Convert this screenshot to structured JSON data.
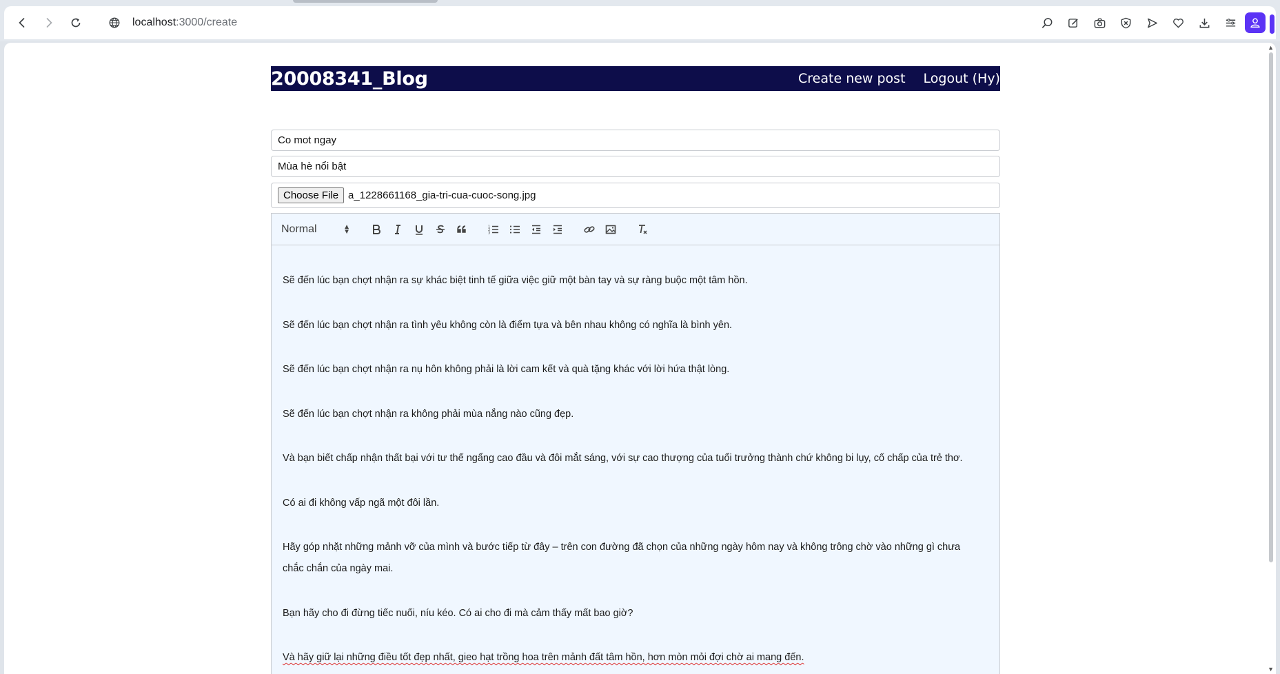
{
  "browser": {
    "url_host": "localhost",
    "url_path": ":3000/create",
    "icons": [
      "back-icon",
      "forward-icon",
      "reload-icon",
      "globe-icon",
      "search-lens-icon",
      "edit-icon",
      "camera-icon",
      "shield-x-icon",
      "send-icon",
      "heart-icon",
      "download-icon",
      "menu-icon",
      "profile-icon"
    ]
  },
  "header": {
    "brand": "20008341_Blog",
    "create_link": "Create new post",
    "logout_link": "Logout (Hy)"
  },
  "form": {
    "title_value": "Co mot ngay",
    "description_value": "Mùa hè nổi bật",
    "file_button": "Choose File",
    "file_name": "a_1228661168_gia-tri-cua-cuoc-song.jpg"
  },
  "editor": {
    "header_picker": "Normal",
    "toolbar_tools": [
      "bold-icon",
      "italic-icon",
      "underline-icon",
      "strike-icon",
      "blockquote-icon",
      "ordered-list-icon",
      "bullet-list-icon",
      "outdent-icon",
      "indent-icon",
      "link-icon",
      "image-icon",
      "clean-icon"
    ],
    "paragraphs": [
      "Sẽ đến lúc bạn chợt nhận ra sự khác biệt tinh tế giữa việc giữ một bàn tay và sự ràng buộc một tâm hồn.",
      "Sẽ đến lúc bạn chợt nhận ra tình yêu không còn là điểm tựa và bên nhau không có nghĩa là bình yên.",
      "Sẽ đến lúc bạn chợt nhận ra nụ hôn không phải là lời cam kết và quà tặng khác với lời hứa thật lòng.",
      "Sẽ đến lúc bạn chợt nhận ra không phải mùa nắng nào cũng đẹp.",
      "Và bạn biết chấp nhận thất bại với tư thế ngẩng cao đầu và đôi mắt sáng, với sự cao thượng của tuổi trưởng thành chứ không bi lụy, cố chấp của trẻ thơ.",
      "Có ai đi không vấp ngã một đôi lần.",
      "Hãy góp nhặt những mảnh vỡ của mình và bước tiếp từ đây – trên con đường đã chọn của những ngày hôm nay và không trông chờ vào những gì chưa chắc chắn của ngày mai.",
      "Bạn hãy cho đi đừng tiếc nuối, níu kéo. Có ai cho đi mà cảm thấy mất bao giờ?",
      "Và hãy giữ lại những điều tốt đẹp nhất, gieo hạt trồng hoa trên mảnh đất tâm hồn, hơn mòn mỏi đợi chờ ai mang đến."
    ]
  }
}
